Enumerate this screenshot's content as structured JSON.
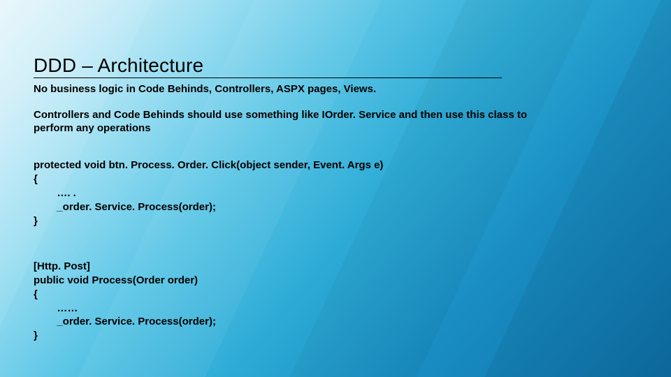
{
  "slide": {
    "title": "DDD – Architecture",
    "p1": "No business logic in Code Behinds, Controllers, ASPX pages, Views.",
    "p2": "Controllers and Code Behinds should use something like IOrder. Service and then use this class to perform any operations",
    "code1_l1": "protected void btn. Process. Order. Click(object sender, Event. Args e)",
    "code1_l2": "{",
    "code1_l3": "        …. .",
    "code1_l4": "        _order. Service. Process(order);",
    "code1_l5": "}",
    "code2_l1": "[Http. Post]",
    "code2_l2": "public void Process(Order order)",
    "code2_l3": "{",
    "code2_l4": "        ……",
    "code2_l5": "        _order. Service. Process(order);",
    "code2_l6": "}"
  }
}
